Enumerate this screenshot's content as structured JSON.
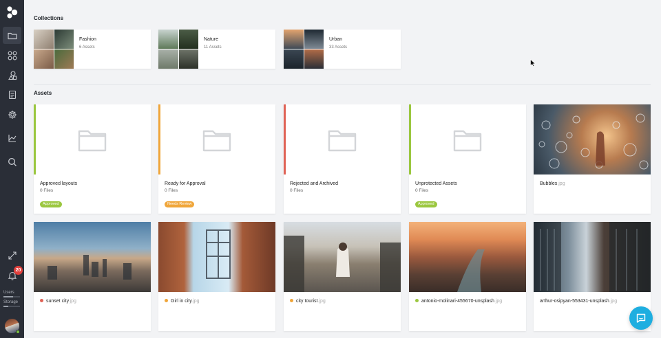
{
  "sidebar": {
    "items": [
      {
        "icon": "folder-icon",
        "active": true
      },
      {
        "icon": "grid-icon",
        "active": false
      },
      {
        "icon": "shapes-icon",
        "active": false
      },
      {
        "icon": "clipboard-icon",
        "active": false
      },
      {
        "icon": "gear-icon",
        "active": false
      },
      {
        "icon": "stack-icon",
        "active": false
      },
      {
        "icon": "search-icon",
        "active": false
      },
      {
        "icon": "expand-icon",
        "active": false
      },
      {
        "icon": "bell-icon",
        "active": false
      }
    ],
    "notification_count": "20",
    "users_label": "Users",
    "storage_label": "Storage"
  },
  "collections": {
    "title": "Collections",
    "items": [
      {
        "name": "Fashion",
        "count": "6 Assets"
      },
      {
        "name": "Nature",
        "count": "11 Assets"
      },
      {
        "name": "Urban",
        "count": "33 Assets"
      }
    ]
  },
  "assets": {
    "title": "Assets",
    "folders": [
      {
        "name": "Approved layouts",
        "files": "0 Files",
        "badge": "Approved",
        "color": "#9bc73f"
      },
      {
        "name": "Ready for Approval",
        "files": "0 Files",
        "badge": "Needs Review",
        "color": "#f0a63a"
      },
      {
        "name": "Rejected and Archived",
        "files": "0 Files",
        "badge": "",
        "color": "#e06356"
      },
      {
        "name": "Unprotected Assets",
        "files": "0 Files",
        "badge": "Approved",
        "color": "#9bc73f"
      }
    ],
    "files": [
      {
        "name": "Bubbles",
        "ext": ".jpg",
        "dot": ""
      },
      {
        "name": "sunset city",
        "ext": ".jpg",
        "dot": "#e06356"
      },
      {
        "name": "Girl in city",
        "ext": ".jpg",
        "dot": "#f0a63a"
      },
      {
        "name": "city tourist",
        "ext": ".jpg",
        "dot": "#f0a63a"
      },
      {
        "name": "antonio-molinari-455670-unsplash",
        "ext": ".jpg",
        "dot": "#9bc73f"
      },
      {
        "name": "arthur-osipyan-553431-unsplash",
        "ext": ".jpg",
        "dot": ""
      }
    ]
  },
  "colors": {
    "sidebar_bg": "#2a2e37",
    "approved": "#9bc73f",
    "needs_review": "#f0a63a",
    "rejected": "#e06356",
    "chat": "#1eaee0"
  }
}
